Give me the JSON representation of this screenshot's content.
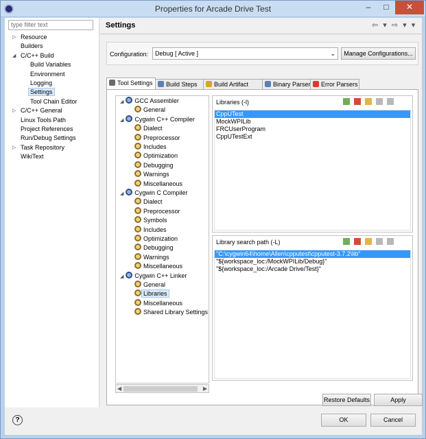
{
  "window": {
    "title": "Properties for Arcade Drive Test",
    "min_glyph": "–",
    "max_glyph": "□",
    "close_glyph": "✕"
  },
  "filter": {
    "placeholder": "type filter text"
  },
  "left_tree": [
    {
      "label": "Resource",
      "arrow": "▷",
      "indent": 0
    },
    {
      "label": "Builders",
      "arrow": "",
      "indent": 0
    },
    {
      "label": "C/C++ Build",
      "arrow": "◢",
      "indent": 0
    },
    {
      "label": "Build Variables",
      "arrow": "",
      "indent": 1
    },
    {
      "label": "Environment",
      "arrow": "",
      "indent": 1
    },
    {
      "label": "Logging",
      "arrow": "",
      "indent": 1
    },
    {
      "label": "Settings",
      "arrow": "",
      "indent": 1,
      "selected": true
    },
    {
      "label": "Tool Chain Editor",
      "arrow": "",
      "indent": 1
    },
    {
      "label": "C/C++ General",
      "arrow": "▷",
      "indent": 0
    },
    {
      "label": "Linux Tools Path",
      "arrow": "",
      "indent": 0
    },
    {
      "label": "Project References",
      "arrow": "",
      "indent": 0
    },
    {
      "label": "Run/Debug Settings",
      "arrow": "",
      "indent": 0
    },
    {
      "label": "Task Repository",
      "arrow": "▷",
      "indent": 0
    },
    {
      "label": "WikiText",
      "arrow": "",
      "indent": 0
    }
  ],
  "header": {
    "title": "Settings",
    "nav": "⇦ ▾ ⇨ ▾ ▾"
  },
  "configuration": {
    "label": "Configuration:",
    "value": "Debug  [ Active ]",
    "manage_label": "Manage Configurations..."
  },
  "tabs": [
    {
      "label": "Tool Settings",
      "active": true,
      "color": "#6b6b6b"
    },
    {
      "label": "Build Steps",
      "active": false,
      "color": "#5a7fb5"
    },
    {
      "label": "Build Artifact",
      "active": false,
      "color": "#d9a620"
    },
    {
      "label": "Binary Parsers",
      "active": false,
      "color": "#5a7fb5"
    },
    {
      "label": "Error Parsers",
      "active": false,
      "color": "#d93a2b"
    }
  ],
  "tool_tree": [
    {
      "label": "GCC Assembler",
      "type": "tool"
    },
    {
      "label": "General",
      "type": "option"
    },
    {
      "label": "Cygwin C++ Compiler",
      "type": "tool"
    },
    {
      "label": "Dialect",
      "type": "option"
    },
    {
      "label": "Preprocessor",
      "type": "option"
    },
    {
      "label": "Includes",
      "type": "option"
    },
    {
      "label": "Optimization",
      "type": "option"
    },
    {
      "label": "Debugging",
      "type": "option"
    },
    {
      "label": "Warnings",
      "type": "option"
    },
    {
      "label": "Miscellaneous",
      "type": "option"
    },
    {
      "label": "Cygwin C Compiler",
      "type": "tool"
    },
    {
      "label": "Dialect",
      "type": "option"
    },
    {
      "label": "Preprocessor",
      "type": "option"
    },
    {
      "label": "Symbols",
      "type": "option"
    },
    {
      "label": "Includes",
      "type": "option"
    },
    {
      "label": "Optimization",
      "type": "option"
    },
    {
      "label": "Debugging",
      "type": "option"
    },
    {
      "label": "Warnings",
      "type": "option"
    },
    {
      "label": "Miscellaneous",
      "type": "option"
    },
    {
      "label": "Cygwin C++ Linker",
      "type": "tool"
    },
    {
      "label": "General",
      "type": "option"
    },
    {
      "label": "Libraries",
      "type": "option",
      "selected": true
    },
    {
      "label": "Miscellaneous",
      "type": "option"
    },
    {
      "label": "Shared Library Settings",
      "type": "option"
    }
  ],
  "libraries": {
    "title": "Libraries (-l)",
    "items": [
      "CppUTest",
      "MockWPILib",
      "FRCUserProgram",
      "CppUTestExt"
    ]
  },
  "search_paths": {
    "title": "Library search path (-L)",
    "items": [
      "\"C:\\cygwin64\\home\\Allen\\cpputest\\cpputest-3.7.2\\lib\"",
      "\"${workspace_loc:/MockWPILib/Debug}\"",
      "\"${workspace_loc:/Arcade Drive/Test}\""
    ]
  },
  "buttons": {
    "restore": "Restore Defaults",
    "apply": "Apply",
    "ok": "OK",
    "cancel": "Cancel",
    "help": "?"
  }
}
